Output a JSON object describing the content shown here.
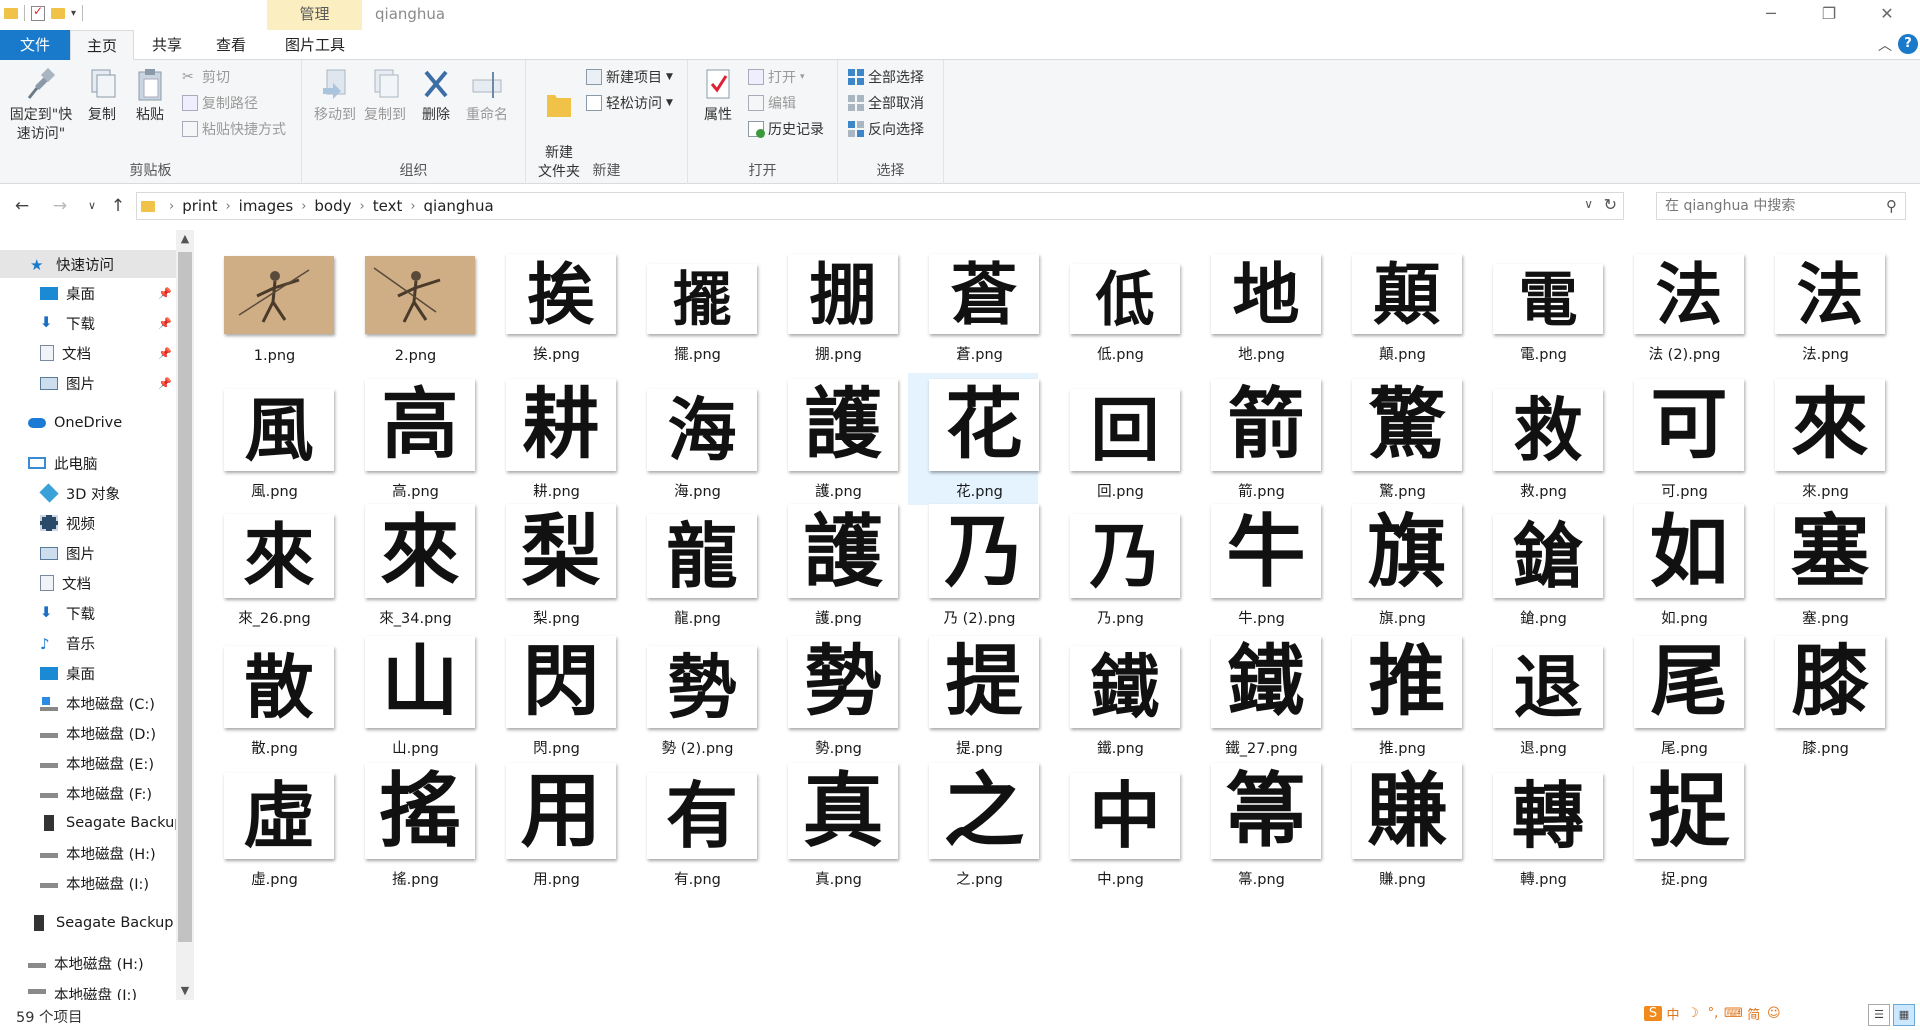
{
  "window": {
    "context_tab": "管理",
    "title": "qianghua",
    "tool_tab": "图片工具"
  },
  "tabs": [
    "文件",
    "主页",
    "共享",
    "查看",
    "图片工具"
  ],
  "ribbon": {
    "clipboard": {
      "label": "剪贴板",
      "pin": "固定到\"快速访问\"",
      "copy": "复制",
      "paste": "粘贴",
      "cut": "剪切",
      "copy_path": "复制路径",
      "paste_shortcut": "粘贴快捷方式"
    },
    "organize": {
      "label": "组织",
      "move_to": "移动到",
      "copy_to": "复制到",
      "delete": "删除",
      "rename": "重命名"
    },
    "new": {
      "label": "新建",
      "new_folder": "新建\n文件夹",
      "new_item": "新建项目",
      "easy_access": "轻松访问"
    },
    "open": {
      "label": "打开",
      "properties": "属性",
      "open": "打开",
      "edit": "编辑",
      "history": "历史记录"
    },
    "select": {
      "label": "选择",
      "select_all": "全部选择",
      "select_none": "全部取消",
      "invert": "反向选择"
    }
  },
  "address": {
    "crumbs": [
      "print",
      "images",
      "body",
      "text",
      "qianghua"
    ],
    "search_placeholder": "在 qianghua 中搜索"
  },
  "nav": {
    "quick_access": "快速访问",
    "qa_items": [
      "桌面",
      "下载",
      "文档",
      "图片"
    ],
    "onedrive": "OneDrive",
    "this_pc": "此电脑",
    "pc_items": [
      "3D 对象",
      "视频",
      "图片",
      "文档",
      "下载",
      "音乐",
      "桌面",
      "本地磁盘 (C:)",
      "本地磁盘 (D:)",
      "本地磁盘 (E:)",
      "本地磁盘 (F:)",
      "Seagate Backup",
      "本地磁盘 (H:)",
      "本地磁盘 (I:)"
    ],
    "seagate": "Seagate Backup",
    "drive_h": "本地磁盘 (H:)",
    "drive_partial": "本地磁盘 (I:)"
  },
  "files": [
    {
      "name": "1.png",
      "glyph": "",
      "kind": "photo"
    },
    {
      "name": "2.png",
      "glyph": "",
      "kind": "photo"
    },
    {
      "name": "挨.png",
      "glyph": "挨"
    },
    {
      "name": "擺.png",
      "glyph": "擺"
    },
    {
      "name": "掤.png",
      "glyph": "掤"
    },
    {
      "name": "蒼.png",
      "glyph": "蒼"
    },
    {
      "name": "低.png",
      "glyph": "低"
    },
    {
      "name": "地.png",
      "glyph": "地"
    },
    {
      "name": "顛.png",
      "glyph": "顛"
    },
    {
      "name": "電.png",
      "glyph": "電"
    },
    {
      "name": "法 (2).png",
      "glyph": "法"
    },
    {
      "name": "法.png",
      "glyph": "法"
    },
    {
      "name": "風.png",
      "glyph": "風"
    },
    {
      "name": "高.png",
      "glyph": "高"
    },
    {
      "name": "耕.png",
      "glyph": "耕"
    },
    {
      "name": "海.png",
      "glyph": "海"
    },
    {
      "name": "護.png",
      "glyph": "護"
    },
    {
      "name": "花.png",
      "glyph": "花",
      "selected": true
    },
    {
      "name": "回.png",
      "glyph": "回"
    },
    {
      "name": "箭.png",
      "glyph": "箭"
    },
    {
      "name": "驚.png",
      "glyph": "驚"
    },
    {
      "name": "救.png",
      "glyph": "救"
    },
    {
      "name": "可.png",
      "glyph": "可"
    },
    {
      "name": "來.png",
      "glyph": "來"
    },
    {
      "name": "來_26.png",
      "glyph": "來"
    },
    {
      "name": "來_34.png",
      "glyph": "來"
    },
    {
      "name": "梨.png",
      "glyph": "梨"
    },
    {
      "name": "龍.png",
      "glyph": "龍"
    },
    {
      "name": "護.png",
      "glyph": "護"
    },
    {
      "name": "乃 (2).png",
      "glyph": "乃"
    },
    {
      "name": "乃.png",
      "glyph": "乃"
    },
    {
      "name": "牛.png",
      "glyph": "牛"
    },
    {
      "name": "旗.png",
      "glyph": "旗"
    },
    {
      "name": "鎗.png",
      "glyph": "鎗"
    },
    {
      "name": "如.png",
      "glyph": "如"
    },
    {
      "name": "塞.png",
      "glyph": "塞"
    },
    {
      "name": "散.png",
      "glyph": "散"
    },
    {
      "name": "山.png",
      "glyph": "山"
    },
    {
      "name": "閃.png",
      "glyph": "閃"
    },
    {
      "name": "勢 (2).png",
      "glyph": "勢"
    },
    {
      "name": "勢.png",
      "glyph": "勢"
    },
    {
      "name": "提.png",
      "glyph": "提"
    },
    {
      "name": "鐵.png",
      "glyph": "鐵"
    },
    {
      "name": "鐵_27.png",
      "glyph": "鐵"
    },
    {
      "name": "推.png",
      "glyph": "推"
    },
    {
      "name": "退.png",
      "glyph": "退"
    },
    {
      "name": "尾.png",
      "glyph": "尾"
    },
    {
      "name": "膝.png",
      "glyph": "膝"
    },
    {
      "name": "虛.png",
      "glyph": "虛"
    },
    {
      "name": "搖.png",
      "glyph": "搖"
    },
    {
      "name": "用.png",
      "glyph": "用"
    },
    {
      "name": "有.png",
      "glyph": "有"
    },
    {
      "name": "真.png",
      "glyph": "真"
    },
    {
      "name": "之.png",
      "glyph": "之"
    },
    {
      "name": "中.png",
      "glyph": "中"
    },
    {
      "name": "箒.png",
      "glyph": "箒"
    },
    {
      "name": "賺.png",
      "glyph": "賺"
    },
    {
      "name": "轉.png",
      "glyph": "轉"
    },
    {
      "name": "捉.png",
      "glyph": "捉"
    }
  ],
  "status": {
    "count_text": "59 个项目",
    "ime_chars": [
      "中",
      "简"
    ]
  },
  "colors": {
    "accent": "#1979ca",
    "selection": "#e5f3ff",
    "context_tab": "#fbeec1"
  }
}
